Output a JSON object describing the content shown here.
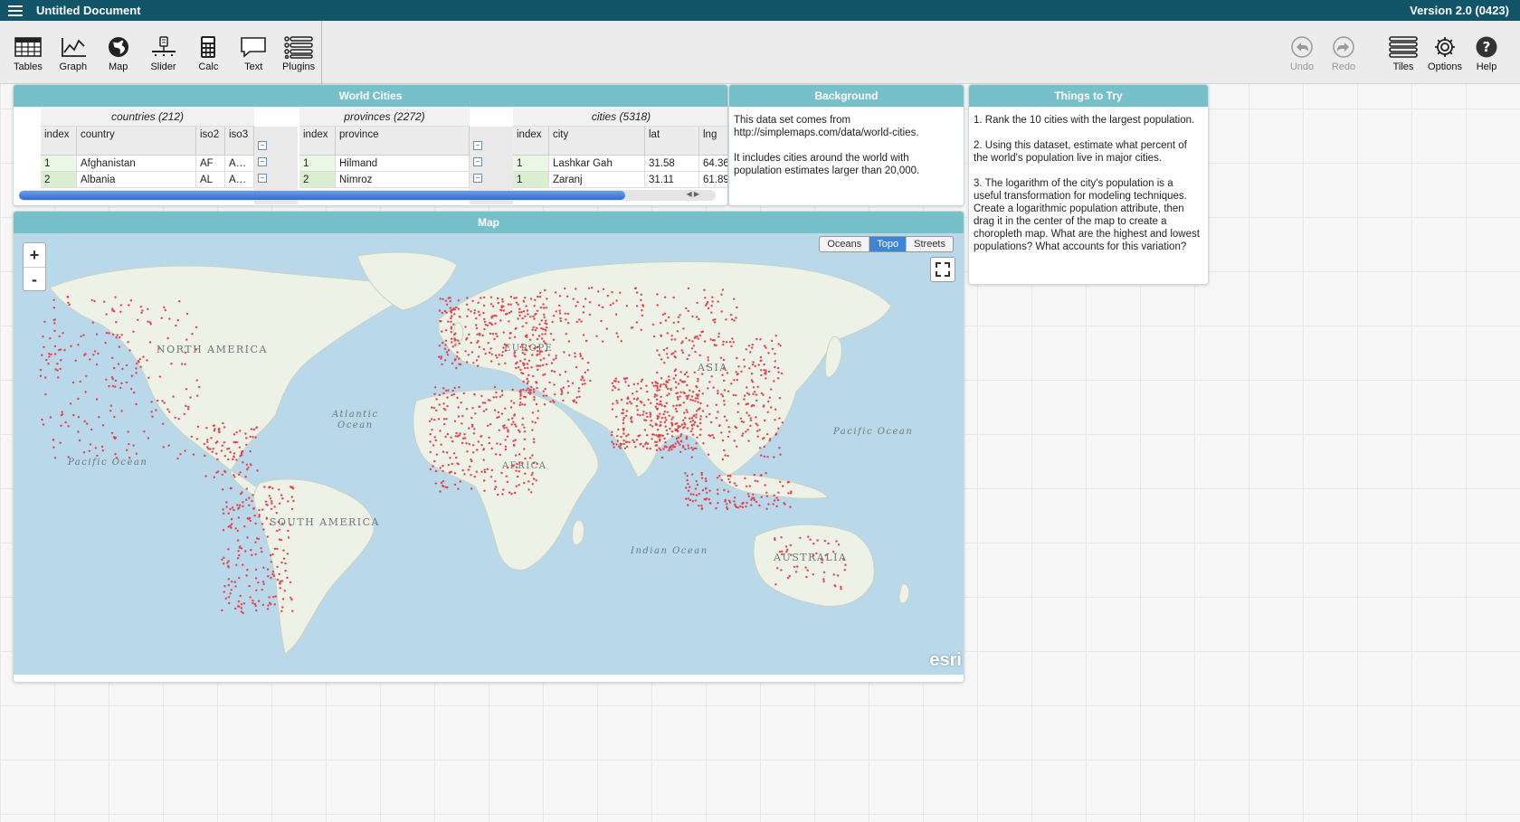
{
  "app": {
    "title": "Untitled Document",
    "version": "Version 2.0 (0423)"
  },
  "toolbar": {
    "left": [
      {
        "label": "Tables",
        "icon": "tables-icon"
      },
      {
        "label": "Graph",
        "icon": "graph-icon"
      },
      {
        "label": "Map",
        "icon": "map-icon"
      },
      {
        "label": "Slider",
        "icon": "slider-icon"
      },
      {
        "label": "Calc",
        "icon": "calc-icon"
      },
      {
        "label": "Text",
        "icon": "text-icon"
      },
      {
        "label": "Plugins",
        "icon": "plugins-icon"
      }
    ],
    "right": [
      {
        "label": "Undo",
        "icon": "undo-icon",
        "disabled": true
      },
      {
        "label": "Redo",
        "icon": "redo-icon",
        "disabled": true
      },
      {
        "label": "Tiles",
        "icon": "tiles-icon"
      },
      {
        "label": "Options",
        "icon": "gear-icon"
      },
      {
        "label": "Help",
        "icon": "help-icon"
      }
    ]
  },
  "table_tile": {
    "title": "World Cities",
    "collections": [
      {
        "name": "countries (212)",
        "columns": [
          "index",
          "country",
          "iso2",
          "iso3"
        ],
        "rows": [
          [
            "1",
            "Afghanistan",
            "AF",
            "A…"
          ],
          [
            "2",
            "Albania",
            "AL",
            "A…"
          ]
        ]
      },
      {
        "name": "provinces (2272)",
        "columns": [
          "index",
          "province"
        ],
        "rows": [
          [
            "1",
            "Hilmand"
          ],
          [
            "2",
            "Nimroz"
          ]
        ]
      },
      {
        "name": "cities (5318)",
        "columns": [
          "index",
          "city",
          "lat",
          "lng"
        ],
        "rows": [
          [
            "1",
            "Lashkar Gah",
            "31.58",
            "64.36"
          ],
          [
            "1",
            "Zaranj",
            "31.11",
            "61.89"
          ]
        ]
      }
    ]
  },
  "background_tile": {
    "title": "Background",
    "paragraphs": [
      "This data set comes from http://simplemaps.com/data/world-cities.",
      "It includes cities around the world with population estimates larger than 20,000."
    ]
  },
  "try_tile": {
    "title": "Things to Try",
    "paragraphs": [
      "1. Rank the 10 cities with the largest population.",
      "2. Using this dataset, estimate what percent of the world's population live in major cities.",
      "3. The logarithm of the city's population is a useful transformation for modeling techniques. Create a logarithmic population attribute, then drag it in the center of the map to create a choropleth map. What are the highest and lowest populations? What accounts for this variation?"
    ]
  },
  "map_tile": {
    "title": "Map",
    "zoom_in": "+",
    "zoom_out": "-",
    "basemaps": [
      "Oceans",
      "Topo",
      "Streets"
    ],
    "active_basemap": "Topo",
    "attribution": "esri",
    "labels": {
      "north_america": "NORTH AMERICA",
      "south_america": "SOUTH AMERICA",
      "europe": "EUROPE",
      "africa": "AFRICA",
      "asia": "ASIA",
      "australia": "AUSTRALIA",
      "atlantic_1": "Atlantic",
      "atlantic_2": "Ocean",
      "pacific_west": "Pacific Ocean",
      "pacific_east": "Pacific Ocean",
      "indian": "Indian Ocean"
    },
    "colors": {
      "ocean": "#b9d8ea",
      "land": "#eef1e6",
      "points": "#e5424b"
    }
  }
}
